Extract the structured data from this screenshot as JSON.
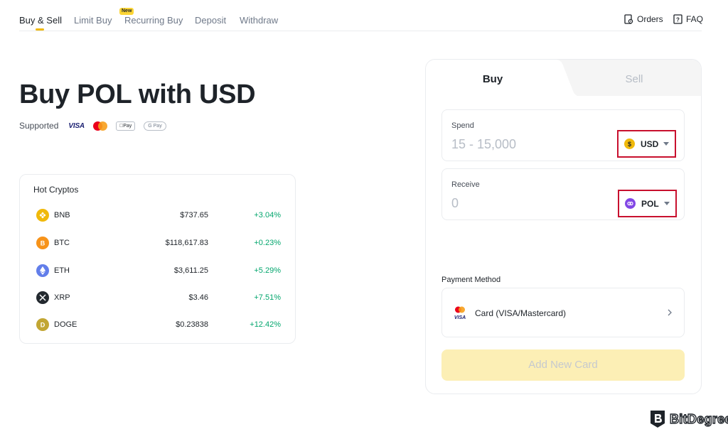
{
  "nav": {
    "tabs": [
      {
        "label": "Buy & Sell"
      },
      {
        "label": "Limit Buy"
      },
      {
        "label": "Recurring Buy"
      },
      {
        "label": "Deposit"
      },
      {
        "label": "Withdraw"
      }
    ],
    "new_badge": "New",
    "orders_label": "Orders",
    "faq_label": "FAQ"
  },
  "heading": {
    "title": "Buy POL with USD",
    "supported_label": "Supported",
    "payment_logos": [
      "VISA",
      "mastercard",
      "Pay",
      "G Pay"
    ]
  },
  "hot_cryptos": {
    "title": "Hot Cryptos",
    "rows": [
      {
        "symbol": "BNB",
        "price": "$737.65",
        "change": "+3.04%",
        "icon_color": "#f0b90b",
        "icon": "bnb-icon"
      },
      {
        "symbol": "BTC",
        "price": "$118,617.83",
        "change": "+0.23%",
        "icon_color": "#f7931a",
        "icon": "btc-icon"
      },
      {
        "symbol": "ETH",
        "price": "$3,611.25",
        "change": "+5.29%",
        "icon_color": "#627eea",
        "icon": "eth-icon"
      },
      {
        "symbol": "XRP",
        "price": "$3.46",
        "change": "+7.51%",
        "icon_color": "#23292f",
        "icon": "xrp-icon"
      },
      {
        "symbol": "DOGE",
        "price": "$0.23838",
        "change": "+12.42%",
        "icon_color": "#c2a633",
        "icon": "doge-icon"
      }
    ]
  },
  "trade": {
    "buy_tab": "Buy",
    "sell_tab": "Sell",
    "spend": {
      "label": "Spend",
      "placeholder": "15 - 15,000",
      "currency": "USD",
      "currency_icon_color": "#f0b90b"
    },
    "receive": {
      "label": "Receive",
      "placeholder": "0",
      "currency": "POL",
      "currency_icon_color": "#8247e5"
    },
    "payment_method_label": "Payment Method",
    "payment_method": "Card (VISA/Mastercard)",
    "add_card_button": "Add New Card"
  },
  "watermark": {
    "text": "BitDegree"
  },
  "colors": {
    "accent": "#fcd535",
    "positive": "#03a66d",
    "highlight_border": "#c8102e"
  }
}
